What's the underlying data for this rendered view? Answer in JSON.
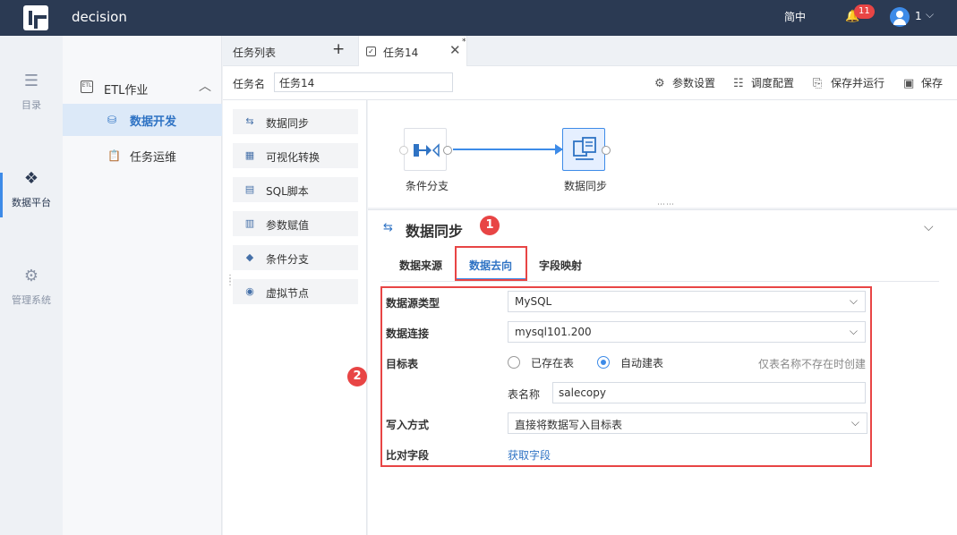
{
  "topbar": {
    "app_name": "decision",
    "language": "简中",
    "notification_count": "11",
    "user_name": "1"
  },
  "leftnav": {
    "items": [
      {
        "label": "目录"
      },
      {
        "label": "数据平台"
      },
      {
        "label": "管理系统"
      }
    ]
  },
  "subnav": {
    "group_label": "ETL作业",
    "items": [
      {
        "label": "数据开发"
      },
      {
        "label": "任务运维"
      }
    ]
  },
  "tabs": {
    "list_label": "任务列表",
    "plus": "+",
    "active_tab": "任务14",
    "close": "✕",
    "modified_mark": "*"
  },
  "toolbar": {
    "task_name_label": "任务名",
    "task_name_value": "任务14",
    "param_settings": "参数设置",
    "schedule_config": "调度配置",
    "save_and_run": "保存并运行",
    "save": "保存"
  },
  "palette": {
    "items": [
      {
        "label": "数据同步"
      },
      {
        "label": "可视化转换"
      },
      {
        "label": "SQL脚本"
      },
      {
        "label": "参数赋值"
      },
      {
        "label": "条件分支"
      },
      {
        "label": "虚拟节点"
      }
    ]
  },
  "canvas": {
    "nodes": [
      {
        "label": "条件分支"
      },
      {
        "label": "数据同步"
      }
    ]
  },
  "panel": {
    "title": "数据同步",
    "markers": [
      "1",
      "2"
    ],
    "tabs": [
      {
        "label": "数据来源"
      },
      {
        "label": "数据去向"
      },
      {
        "label": "字段映射"
      }
    ],
    "active_tab_index": 1,
    "form": {
      "datasource_type_label": "数据源类型",
      "datasource_type_value": "MySQL",
      "connection_label": "数据连接",
      "connection_value": "mysql101.200",
      "target_table_label": "目标表",
      "radio_existing": "已存在表",
      "radio_auto": "自动建表",
      "radio_selected": "自动建表",
      "hint": "仅表名称不存在时创建",
      "table_name_label": "表名称",
      "table_name_value": "salecopy",
      "write_mode_label": "写入方式",
      "write_mode_value": "直接将数据写入目标表",
      "compare_fields_label": "比对字段",
      "fetch_fields_link": "获取字段"
    }
  },
  "colors": {
    "topbar": "#2b3a53",
    "accent": "#3d8be8",
    "highlight": "#e84545"
  }
}
